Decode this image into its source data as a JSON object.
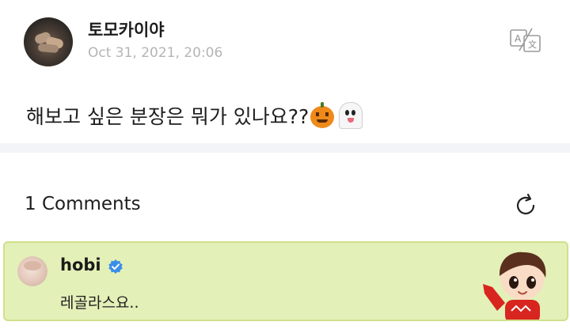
{
  "post": {
    "author": "토모카이야",
    "date": "Oct 31, 2021, 20:06",
    "body_text": "해보고 싶은 분장은 뭐가 있나요??",
    "emojis": [
      "pumpkin-emoji",
      "ghost-emoji"
    ]
  },
  "comments": {
    "title": "1 Comments",
    "items": [
      {
        "author": "hobi",
        "verified": true,
        "text": "레골라스요..",
        "highlight_color": "#e3f0b8"
      }
    ]
  },
  "icons": {
    "translate": "translate-icon",
    "refresh": "refresh-icon",
    "verified": "verified-badge-icon"
  },
  "colors": {
    "verified": "#3b8ee8",
    "date": "#b5b5b5",
    "card_background": "#e3f0b8",
    "card_border": "#cfe08c"
  }
}
